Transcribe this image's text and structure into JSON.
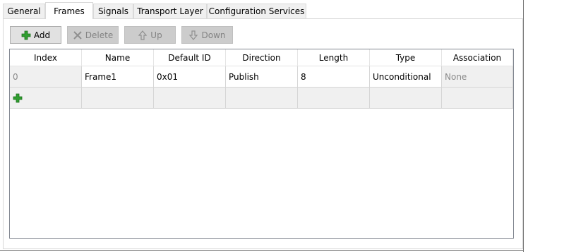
{
  "tabs": [
    {
      "label": "General",
      "active": false
    },
    {
      "label": "Frames",
      "active": true
    },
    {
      "label": "Signals",
      "active": false
    },
    {
      "label": "Transport Layer",
      "active": false
    },
    {
      "label": "Configuration Services",
      "active": false
    }
  ],
  "toolbar": {
    "add_label": "Add",
    "delete_label": "Delete",
    "up_label": "Up",
    "down_label": "Down"
  },
  "grid": {
    "columns": [
      "Index",
      "Name",
      "Default ID",
      "Direction",
      "Length",
      "Type",
      "Association"
    ],
    "rows": [
      {
        "index": "0",
        "name": "Frame1",
        "default_id": "0x01",
        "direction": "Publish",
        "length": "8",
        "type": "Unconditional",
        "association": "None"
      }
    ],
    "new_row_icon": "plus-icon"
  },
  "colors": {
    "plus_green": "#2f9e2f",
    "disabled_text": "#838383",
    "grid_border": "#828790"
  }
}
